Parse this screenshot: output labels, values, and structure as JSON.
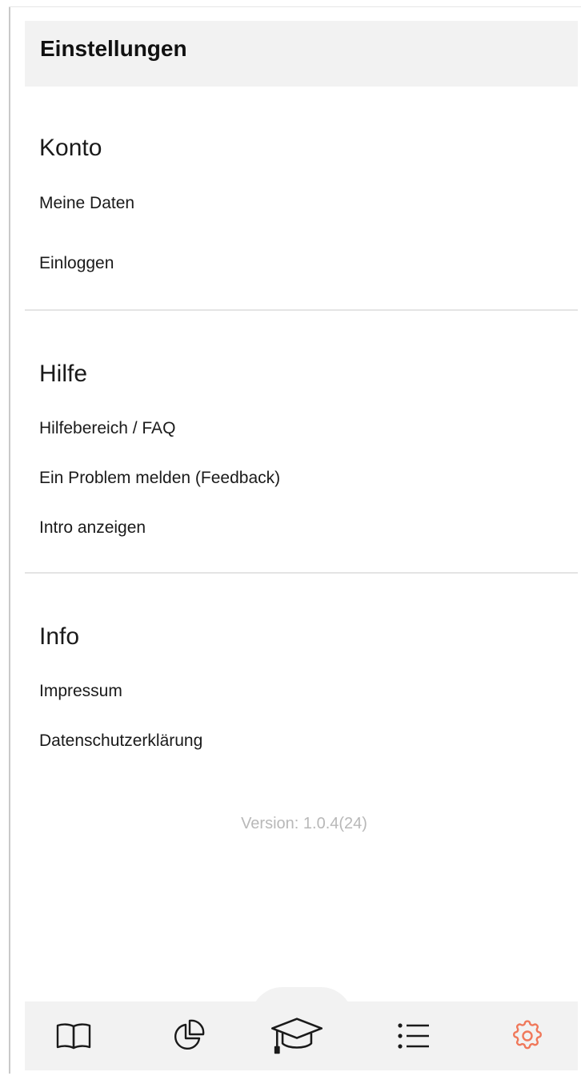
{
  "header": {
    "title": "Einstellungen"
  },
  "sections": [
    {
      "title": "Konto",
      "items": [
        "Meine Daten",
        "Einloggen"
      ]
    },
    {
      "title": "Hilfe",
      "items": [
        "Hilfebereich / FAQ",
        "Ein Problem melden (Feedback)",
        "Intro anzeigen"
      ]
    },
    {
      "title": "Info",
      "items": [
        "Impressum",
        "Datenschutzerklärung"
      ]
    }
  ],
  "version": "Version: 1.0.4(24)",
  "tabbar": {
    "tabs": [
      {
        "icon": "book-icon",
        "active": false
      },
      {
        "icon": "pie-chart-icon",
        "active": false
      },
      {
        "icon": "graduation-cap-icon",
        "active": false
      },
      {
        "icon": "list-icon",
        "active": false
      },
      {
        "icon": "gear-icon",
        "active": true
      }
    ],
    "active_color": "#f0785a",
    "inactive_color": "#1a1a1a"
  }
}
